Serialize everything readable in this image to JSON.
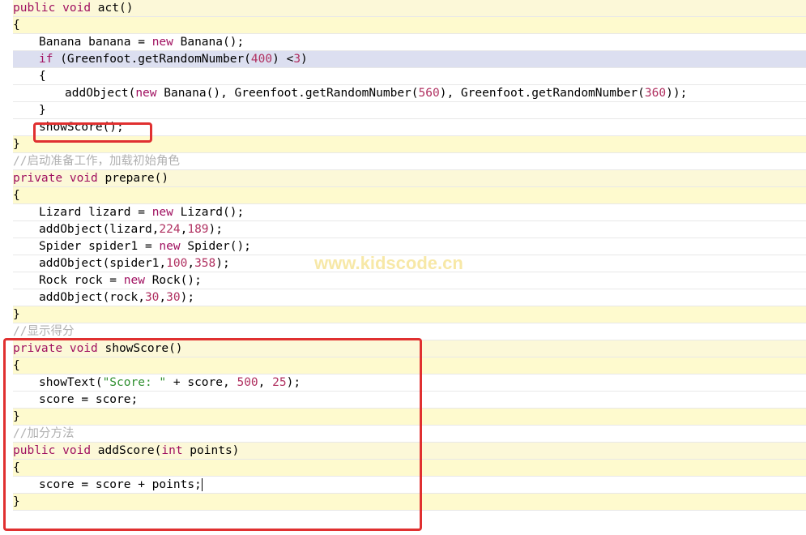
{
  "watermark": "www.kidscode.cn",
  "code": {
    "l1_kw1": "public",
    "l1_kw2": "void",
    "l1_name": " act()",
    "l2": "{",
    "l3_a": "Banana banana = ",
    "l3_kw": "new",
    "l3_b": " Banana();",
    "l4_kw": "if",
    "l4_a": " (Greenfoot.getRandomNumber(",
    "l4_n1": "400",
    "l4_b": ") <",
    "l4_n2": "3",
    "l4_c": ")",
    "l5": "{",
    "l6_a": "addObject(",
    "l6_kw": "new",
    "l6_b": " Banana(), Greenfoot.getRandomNumber(",
    "l6_n1": "560",
    "l6_c": "), Greenfoot.getRandomNumber(",
    "l6_n2": "360",
    "l6_d": "));",
    "l7": "}",
    "l8": "showScore();",
    "l9": "}",
    "c1": "//启动准备工作，加载初始角色",
    "l10_kw1": "private",
    "l10_kw2": "void",
    "l10_name": " prepare()",
    "l11": "{",
    "l12_a": "Lizard lizard = ",
    "l12_kw": "new",
    "l12_b": " Lizard();",
    "l13_a": "addObject(lizard,",
    "l13_n1": "224",
    "l13_c": ",",
    "l13_n2": "189",
    "l13_d": ");",
    "l14_a": "Spider spider1 = ",
    "l14_kw": "new",
    "l14_b": " Spider();",
    "l15_a": "addObject(spider1,",
    "l15_n1": "100",
    "l15_c": ",",
    "l15_n2": "358",
    "l15_d": ");",
    "l16_a": "Rock rock = ",
    "l16_kw": "new",
    "l16_b": " Rock();",
    "l17_a": "addObject(rock,",
    "l17_n1": "30",
    "l17_c": ",",
    "l17_n2": "30",
    "l17_d": ");",
    "l18": "}",
    "c2": "//显示得分",
    "l19_kw1": "private",
    "l19_kw2": "void",
    "l19_name": " showScore()",
    "l20": "{",
    "l21_a": "showText(",
    "l21_str": "\"Score: \"",
    "l21_b": " + score, ",
    "l21_n1": "500",
    "l21_c": ", ",
    "l21_n2": "25",
    "l21_d": ");",
    "l22": "score = score;",
    "l23": "}",
    "c3": "//加分方法",
    "l24_kw1": "public",
    "l24_kw2": "void",
    "l24_a": " addScore(",
    "l24_kw3": "int",
    "l24_b": " points)",
    "l25": "{",
    "l26": "score = score + points;",
    "l27": "}"
  }
}
